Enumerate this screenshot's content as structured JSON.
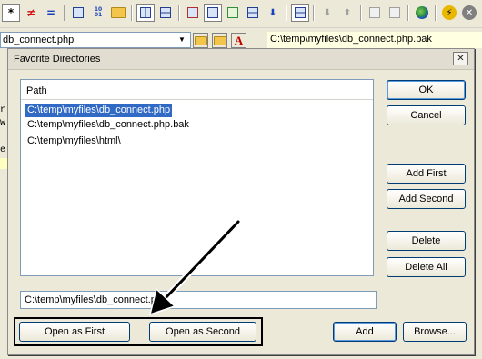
{
  "toolbar": {
    "icons": [
      "asterisk-icon",
      "not-equal-icon",
      "equal-icon",
      "copy-lines-icon",
      "binary-icon",
      "folder-open-icon",
      "vertical-split-icon",
      "horizontal-split-icon",
      "compare-icon",
      "panel-icon",
      "report-icon",
      "wrap-icon",
      "sort-icon",
      "frame-icon",
      "next-diff-icon",
      "prev-diff-icon",
      "sync-left-icon",
      "sync-right-icon",
      "globe-icon",
      "bolt-icon",
      "stop-icon"
    ],
    "glyphs": {
      "asterisk": "*",
      "not_equal": "≠",
      "equal": "=",
      "binary": "10\n01",
      "bolt": "⚡",
      "stop": "✕",
      "down": "⬇",
      "up": "⬆"
    }
  },
  "left_file": {
    "value": "db_connect.php"
  },
  "right_file": {
    "value": "C:\\temp\\myfiles\\db_connect.php.bak"
  },
  "background_text": [
    "r",
    "w",
    "e"
  ],
  "dialog": {
    "title": "Favorite Directories",
    "close_glyph": "✕",
    "list": {
      "column_header": "Path",
      "rows": [
        "C:\\temp\\myfiles\\db_connect.php",
        "C:\\temp\\myfiles\\db_connect.php.bak",
        "C:\\temp\\myfiles\\html\\"
      ],
      "selected_index": 0
    },
    "buttons": {
      "ok": "OK",
      "cancel": "Cancel",
      "add_first": "Add First",
      "add_second": "Add Second",
      "delete": "Delete",
      "delete_all": "Delete All",
      "open_as_first": "Open as First",
      "open_as_second": "Open as Second",
      "add": "Add",
      "browse": "Browse..."
    },
    "path_input": {
      "value": "C:\\temp\\myfiles\\db_connect.php"
    }
  },
  "colors": {
    "selection": "#316ac5",
    "dialog_bg": "#ece9d8",
    "tooltip_yellow": "#ffffe1",
    "annotation": "#000000"
  }
}
